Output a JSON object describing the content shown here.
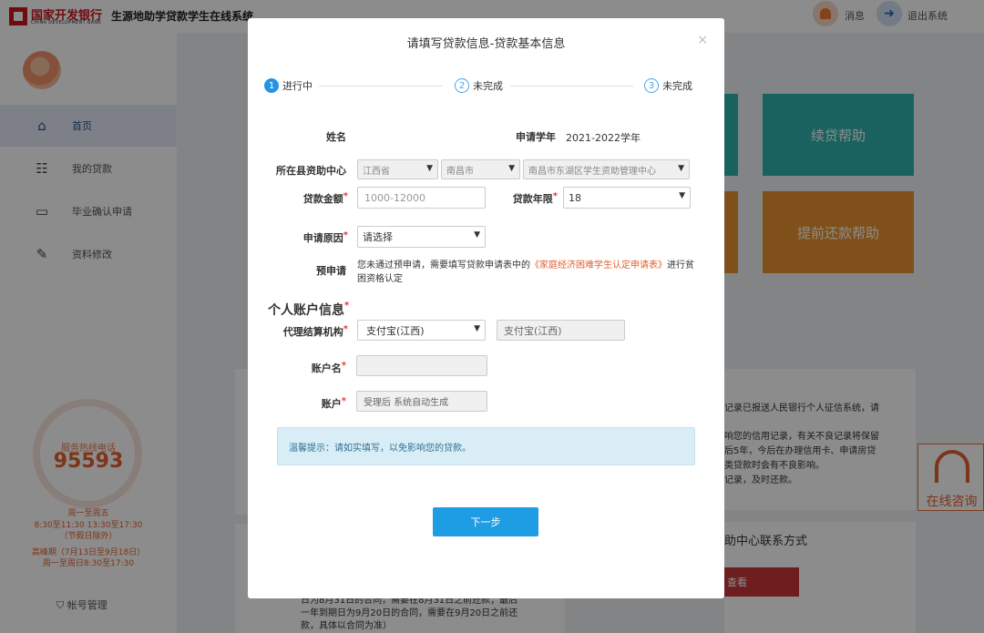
{
  "header": {
    "bank_name": "国家开发银行",
    "bank_name_en": "CHINA DEVELOPMENT BANK",
    "system_title": "生源地助学贷款学生在线系统",
    "messages_label": "消息",
    "logout_label": "退出系统"
  },
  "sidebar": {
    "items": [
      {
        "label": "首页",
        "icon": "home-icon"
      },
      {
        "label": "我的贷款",
        "icon": "document-list-icon"
      },
      {
        "label": "毕业确认申请",
        "icon": "inbox-icon"
      },
      {
        "label": "资料修改",
        "icon": "edit-icon"
      }
    ],
    "hotline_label": "服务热线电话",
    "hotline_number": "95593",
    "hours_1": "周一至周五",
    "hours_2": "8:30至11:30 13:30至17:30",
    "hours_3": "（节假日除外）",
    "hours_4": "高峰期（7月13日至9月18日）",
    "hours_5": "周一至周日8:30至17:30",
    "account_label": "帐号管理"
  },
  "background": {
    "tile_renew": "续贷帮助",
    "tile_prepay": "提前还款帮助",
    "notice_1": "记录已报送人民银行个人征信系统，请",
    "notice_2": "响您的信用记录，有关不良记录将保留",
    "notice_3": "后5年，今后在办理信用卡、申请房贷",
    "notice_4": "类贷款时会有不良影响。",
    "notice_5": "记录，及时还款。",
    "contact_title": "助中心联系方式",
    "view_label": "查看",
    "bottom_1": "日为8月31日的合同，需要在8月31日之前还款；最后",
    "bottom_2": "一年到期日为9月20日的合同，需要在9月20日之前还",
    "bottom_3": "款，具体以合同为准）",
    "consult_label": "在线咨询"
  },
  "modal": {
    "title": "请填写贷款信息-贷款基本信息",
    "close": "×",
    "steps": [
      {
        "num": "1",
        "label": "进行中"
      },
      {
        "num": "2",
        "label": "未完成"
      },
      {
        "num": "3",
        "label": "未完成"
      }
    ],
    "name_label": "姓名",
    "school_year_label": "申请学年",
    "school_year_value": "2021-2022学年",
    "county_center_label": "所在县资助中心",
    "province": "江西省",
    "city": "南昌市",
    "center": "南昌市东湖区学生资助管理中心",
    "amount_label": "贷款金额",
    "amount_placeholder": "1000-12000",
    "term_label": "贷款年限",
    "term_value": "18",
    "reason_label": "申请原因",
    "reason_value": "请选择",
    "pre_apply_label": "预申请",
    "pre_apply_note_1": "您未通过预申请，需要填写贷款申请表中的",
    "pre_apply_note_link": "《家庭经济困难学生认定申请表》",
    "pre_apply_note_2": "进行贫困资格认定",
    "section_title": "个人账户信息",
    "agent_label": "代理结算机构",
    "agent_value": "支付宝(江西)",
    "agent_display": "支付宝(江西)",
    "account_name_label": "账户名",
    "account_label": "账户",
    "account_placeholder": "受理后 系统自动生成",
    "tip": "温馨提示：请如实填写，以免影响您的贷款。",
    "next_button": "下一步"
  },
  "colors": {
    "primary_blue": "#1e9de4",
    "brand_red": "#c8161d",
    "tile_teal": "#2fb3ad",
    "tile_orange": "#e8922e",
    "hotline_orange": "#e4602e"
  }
}
